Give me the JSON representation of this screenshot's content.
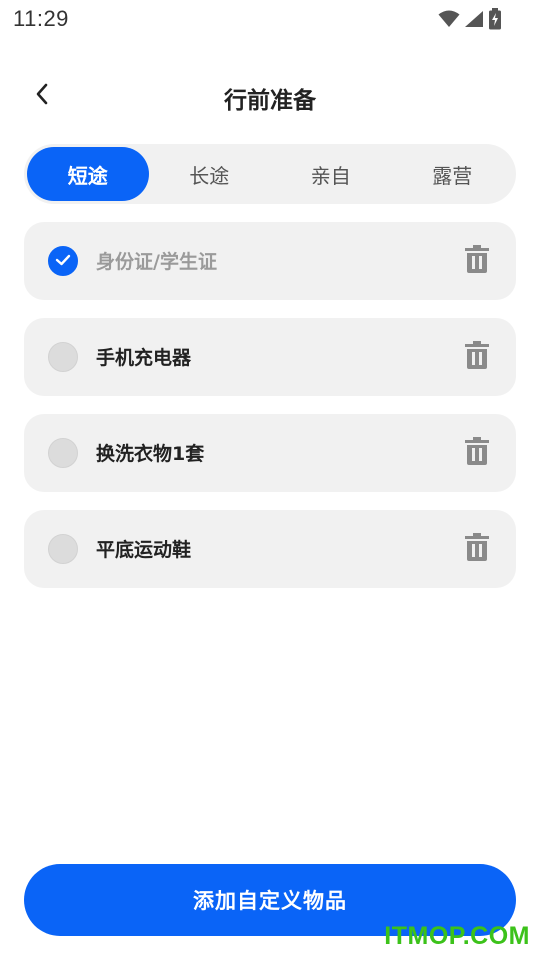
{
  "status_bar": {
    "time": "11:29"
  },
  "header": {
    "title": "行前准备"
  },
  "tabs": [
    {
      "label": "短途",
      "active": true
    },
    {
      "label": "长途",
      "active": false
    },
    {
      "label": "亲自",
      "active": false
    },
    {
      "label": "露营",
      "active": false
    }
  ],
  "items": [
    {
      "label": "身份证/学生证",
      "checked": true
    },
    {
      "label": "手机充电器",
      "checked": false
    },
    {
      "label": "换洗衣物1套",
      "checked": false
    },
    {
      "label": "平底运动鞋",
      "checked": false
    }
  ],
  "add_button": {
    "label": "添加自定义物品"
  },
  "watermark": {
    "text": "ITMOP.COM"
  },
  "colors": {
    "accent": "#0a64f7",
    "card": "#f1f1f1",
    "watermark": "#3cc21a"
  }
}
